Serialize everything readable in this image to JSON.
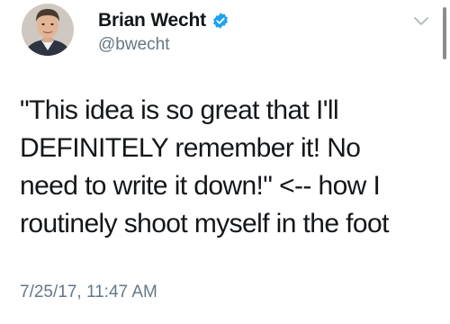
{
  "author": {
    "display_name": "Brian Wecht",
    "handle": "@bwecht",
    "verified": true,
    "avatar_icon": "profile-photo"
  },
  "tweet": {
    "text": "\"This idea is so great that I'll\nDEFINITELY remember it! No\nneed to write it down!\" <-- how I\nroutinely shoot myself in the foot",
    "timestamp": "7/25/17, 11:47 AM"
  },
  "icons": {
    "verified": "verified-badge-icon",
    "menu": "chevron-down-icon"
  },
  "colors": {
    "text": "#14171a",
    "secondary": "#657786",
    "verified_blue": "#1da1f2",
    "chevron": "#aab8c2"
  }
}
